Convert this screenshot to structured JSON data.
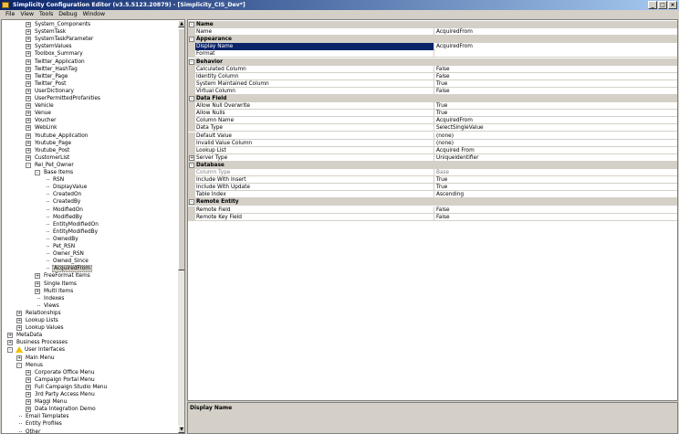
{
  "window": {
    "title": "Simplicity Configuration Editor (v3.5.5123.20879) - [Simplicity_CIS_Dev*]",
    "minimize": "_",
    "maximize": "□",
    "close": "×"
  },
  "menu": {
    "items": [
      "File",
      "View",
      "Tools",
      "Debug",
      "Window"
    ]
  },
  "tree": {
    "rows": [
      {
        "label": "System_Components",
        "level": 3,
        "exp": "+"
      },
      {
        "label": "SystemTask",
        "level": 3,
        "exp": "+"
      },
      {
        "label": "SystemTaskParameter",
        "level": 3,
        "exp": "+"
      },
      {
        "label": "SystemValues",
        "level": 3,
        "exp": "+"
      },
      {
        "label": "Toolbox_Summary",
        "level": 3,
        "exp": "+"
      },
      {
        "label": "Twitter_Application",
        "level": 3,
        "exp": "+"
      },
      {
        "label": "Twitter_HashTag",
        "level": 3,
        "exp": "+"
      },
      {
        "label": "Twitter_Page",
        "level": 3,
        "exp": "+"
      },
      {
        "label": "Twitter_Post",
        "level": 3,
        "exp": "+"
      },
      {
        "label": "UserDictionary",
        "level": 3,
        "exp": "+"
      },
      {
        "label": "UserPermittedProfanities",
        "level": 3,
        "exp": "+"
      },
      {
        "label": "Vehicle",
        "level": 3,
        "exp": "+"
      },
      {
        "label": "Venue",
        "level": 3,
        "exp": "+"
      },
      {
        "label": "Voucher",
        "level": 3,
        "exp": "+"
      },
      {
        "label": "WebLink",
        "level": 3,
        "exp": "+"
      },
      {
        "label": "Youtube_Application",
        "level": 3,
        "exp": "+"
      },
      {
        "label": "Youtube_Page",
        "level": 3,
        "exp": "+"
      },
      {
        "label": "Youtube_Post",
        "level": 3,
        "exp": "+"
      },
      {
        "label": "CustomerList",
        "level": 3,
        "exp": "+"
      },
      {
        "label": "Rel_Pet_Owner",
        "level": 3,
        "exp": "-"
      },
      {
        "label": "Base Items",
        "level": 4,
        "exp": "-"
      },
      {
        "label": "RSN",
        "level": 5,
        "exp": ""
      },
      {
        "label": "DisplayValue",
        "level": 5,
        "exp": ""
      },
      {
        "label": "CreatedOn",
        "level": 5,
        "exp": ""
      },
      {
        "label": "CreatedBy",
        "level": 5,
        "exp": ""
      },
      {
        "label": "ModifiedOn",
        "level": 5,
        "exp": ""
      },
      {
        "label": "ModifiedBy",
        "level": 5,
        "exp": ""
      },
      {
        "label": "EntityModifiedOn",
        "level": 5,
        "exp": ""
      },
      {
        "label": "EntityModifiedBy",
        "level": 5,
        "exp": ""
      },
      {
        "label": "OwnedBy",
        "level": 5,
        "exp": ""
      },
      {
        "label": "Pet_RSN",
        "level": 5,
        "exp": ""
      },
      {
        "label": "Owner_RSN",
        "level": 5,
        "exp": ""
      },
      {
        "label": "Owned_Since",
        "level": 5,
        "exp": ""
      },
      {
        "label": "AcquiredFrom",
        "level": 5,
        "exp": "",
        "selected": true
      },
      {
        "label": "FreeFormat Items",
        "level": 4,
        "exp": "+"
      },
      {
        "label": "Single Items",
        "level": 4,
        "exp": "+"
      },
      {
        "label": "Multi Items",
        "level": 4,
        "exp": "+"
      },
      {
        "label": "Indexes",
        "level": 4,
        "exp": ""
      },
      {
        "label": "Views",
        "level": 4,
        "exp": ""
      },
      {
        "label": "Relationships",
        "level": 2,
        "exp": "+"
      },
      {
        "label": "Lookup Lists",
        "level": 2,
        "exp": "+"
      },
      {
        "label": "Lookup Values",
        "level": 2,
        "exp": "+"
      },
      {
        "label": "MetaData",
        "level": 1,
        "exp": "+"
      },
      {
        "label": "Business Processes",
        "level": 1,
        "exp": "+"
      },
      {
        "label": "User Interfaces",
        "level": 1,
        "exp": "-",
        "warn": true
      },
      {
        "label": "Main Menu",
        "level": 2,
        "exp": "+"
      },
      {
        "label": "Menus",
        "level": 2,
        "exp": "-"
      },
      {
        "label": "Corporate Office Menu",
        "level": 3,
        "exp": "+"
      },
      {
        "label": "Campaign Portal Menu",
        "level": 3,
        "exp": "+"
      },
      {
        "label": "Full Campaign Studio Menu",
        "level": 3,
        "exp": "+"
      },
      {
        "label": "3rd Party Access Menu",
        "level": 3,
        "exp": "+"
      },
      {
        "label": "Maggi Menu",
        "level": 3,
        "exp": "+"
      },
      {
        "label": "Data Integration Demo",
        "level": 3,
        "exp": "+"
      },
      {
        "label": "Email Templates",
        "level": 2,
        "exp": ""
      },
      {
        "label": "Entity Profiles",
        "level": 2,
        "exp": ""
      },
      {
        "label": "Other",
        "level": 2,
        "exp": ""
      }
    ]
  },
  "props": {
    "rows": [
      {
        "kind": "cat",
        "name": "Name",
        "exp": "-"
      },
      {
        "kind": "prop",
        "name": "Name",
        "value": "AcquiredFrom"
      },
      {
        "kind": "cat",
        "name": "Appearance",
        "exp": "-"
      },
      {
        "kind": "prop",
        "name": "Display Name",
        "value": "AcquiredFrom",
        "selected": true
      },
      {
        "kind": "prop",
        "name": "Format",
        "value": ""
      },
      {
        "kind": "cat",
        "name": "Behavior",
        "exp": "-"
      },
      {
        "kind": "prop",
        "name": "Calculated Column",
        "value": "False"
      },
      {
        "kind": "prop",
        "name": "Identity Column",
        "value": "False"
      },
      {
        "kind": "prop",
        "name": "System Maintained Column",
        "value": "True"
      },
      {
        "kind": "prop",
        "name": "Virtual Column",
        "value": "False"
      },
      {
        "kind": "cat",
        "name": "Data Field",
        "exp": "-"
      },
      {
        "kind": "prop",
        "name": "Allow Null Overwrite",
        "value": "True"
      },
      {
        "kind": "prop",
        "name": "Allow Nulls",
        "value": "True"
      },
      {
        "kind": "prop",
        "name": "Column Name",
        "value": "AcquiredFrom"
      },
      {
        "kind": "prop",
        "name": "Data Type",
        "value": "SelectSingleValue"
      },
      {
        "kind": "prop",
        "name": "Default Value",
        "value": "(none)"
      },
      {
        "kind": "prop",
        "name": "Invalid Value Column",
        "value": "(none)"
      },
      {
        "kind": "prop",
        "name": "Lookup List",
        "value": "Acquired From"
      },
      {
        "kind": "prop",
        "name": "Server Type",
        "value": "Uniqueidentifier",
        "exp": "+"
      },
      {
        "kind": "cat",
        "name": "Database",
        "exp": "-"
      },
      {
        "kind": "prop",
        "name": "Column Type",
        "value": "Base",
        "disabled": true
      },
      {
        "kind": "prop",
        "name": "Include With Insert",
        "value": "True"
      },
      {
        "kind": "prop",
        "name": "Include With Update",
        "value": "True"
      },
      {
        "kind": "prop",
        "name": "Table Index",
        "value": "Ascending"
      },
      {
        "kind": "cat",
        "name": "Remote Entity",
        "exp": "-"
      },
      {
        "kind": "prop",
        "name": "Remote Field",
        "value": "False"
      },
      {
        "kind": "prop",
        "name": "Remote Key Field",
        "value": "False"
      }
    ]
  },
  "description": {
    "title": "Display Name"
  }
}
